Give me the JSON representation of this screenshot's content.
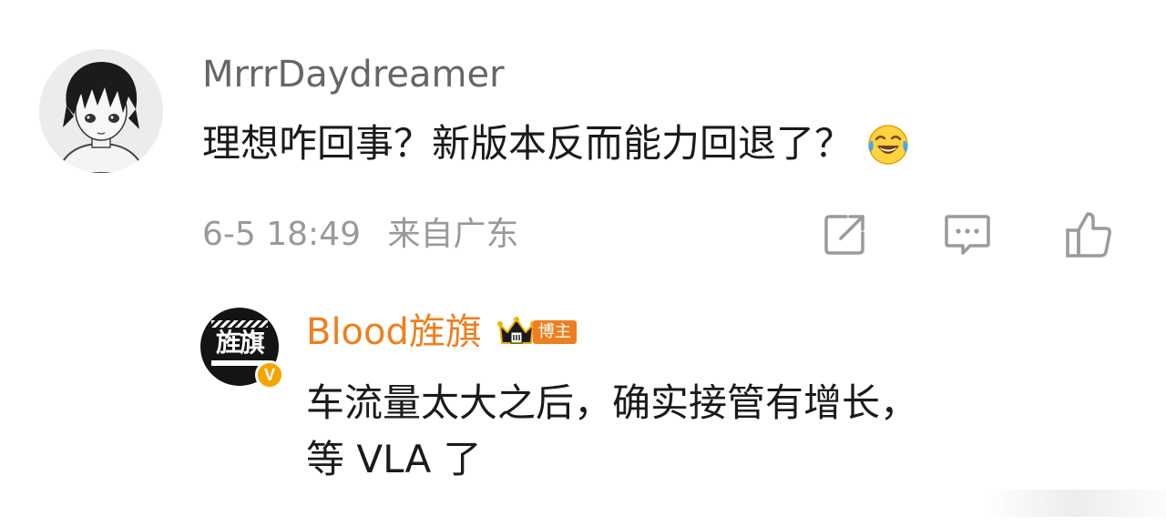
{
  "comment": {
    "username": "MrrrDaydreamer",
    "text": "理想咋回事？新版本反而能力回退了？",
    "emoji_icon": "laughing-crying-emoji-icon",
    "date": "6-5 18:49",
    "location": "来自广东",
    "actions": [
      "share-icon",
      "comment-icon",
      "like-icon"
    ]
  },
  "reply": {
    "username": "Blood旌旗",
    "badge_label": "博主",
    "avatar_logo_text": "旌旗",
    "verified_badge": "V",
    "text_line1": "车流量太大之后，确实接管有增长，",
    "text_line2": "等 VLA 了"
  },
  "colors": {
    "username_gray": "#666666",
    "meta_gray": "#999999",
    "accent_orange": "#ee7f1e",
    "verified_gold": "#f7a400",
    "text": "#1a1a1a"
  }
}
